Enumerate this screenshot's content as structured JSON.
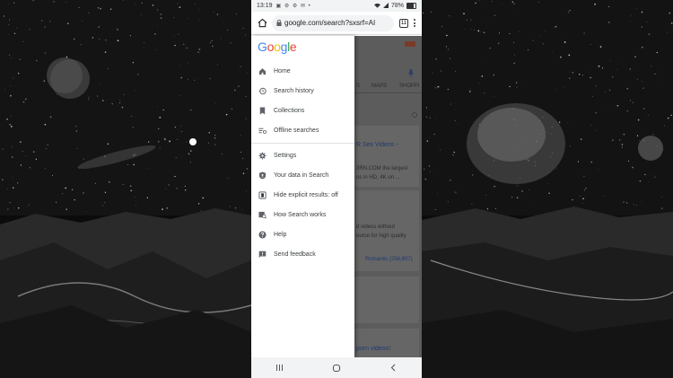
{
  "status_bar": {
    "time": "13:19",
    "notification_icons": "▣ ⚙ ⚙ ✉ •",
    "battery_percent": "78%"
  },
  "browser": {
    "url": "google.com/search?sxsrf=AI",
    "tab_count": "11"
  },
  "drawer": {
    "logo_letters": [
      {
        "ch": "G",
        "color": "#4285F4"
      },
      {
        "ch": "o",
        "color": "#EA4335"
      },
      {
        "ch": "o",
        "color": "#FBBC05"
      },
      {
        "ch": "g",
        "color": "#4285F4"
      },
      {
        "ch": "l",
        "color": "#34A853"
      },
      {
        "ch": "e",
        "color": "#EA4335"
      }
    ],
    "items": [
      {
        "label": "Home",
        "icon": "home-icon"
      },
      {
        "label": "Search history",
        "icon": "history-icon"
      },
      {
        "label": "Collections",
        "icon": "bookmark-icon"
      },
      {
        "label": "Offline searches",
        "icon": "offline-icon"
      },
      {
        "label": "Settings",
        "icon": "gear-icon"
      },
      {
        "label": "Your data in Search",
        "icon": "shield-icon"
      },
      {
        "label": "Hide explicit results: off",
        "icon": "explicit-icon"
      },
      {
        "label": "How Search works",
        "icon": "search-works-icon"
      },
      {
        "label": "Help",
        "icon": "help-icon"
      },
      {
        "label": "Send feedback",
        "icon": "feedback-icon"
      }
    ]
  },
  "page_behind": {
    "tabs": [
      "MAPS",
      "SHOPPI"
    ],
    "result1_title": "R Sex Videos -",
    "result1_snippet_a": "3RN.COM the largest",
    "result1_snippet_b": "os in HD, 4K on ...",
    "result2_snippet_a": "d videos without",
    "result2_snippet_b": "ource for high quality",
    "result2_link": "Romantic (256,607)",
    "result3_title": "porn videos!"
  },
  "colors": {
    "drawer_bg": "#ffffff",
    "dim_overlay": "#5c5c5c",
    "link_blue": "#1a0dab"
  }
}
